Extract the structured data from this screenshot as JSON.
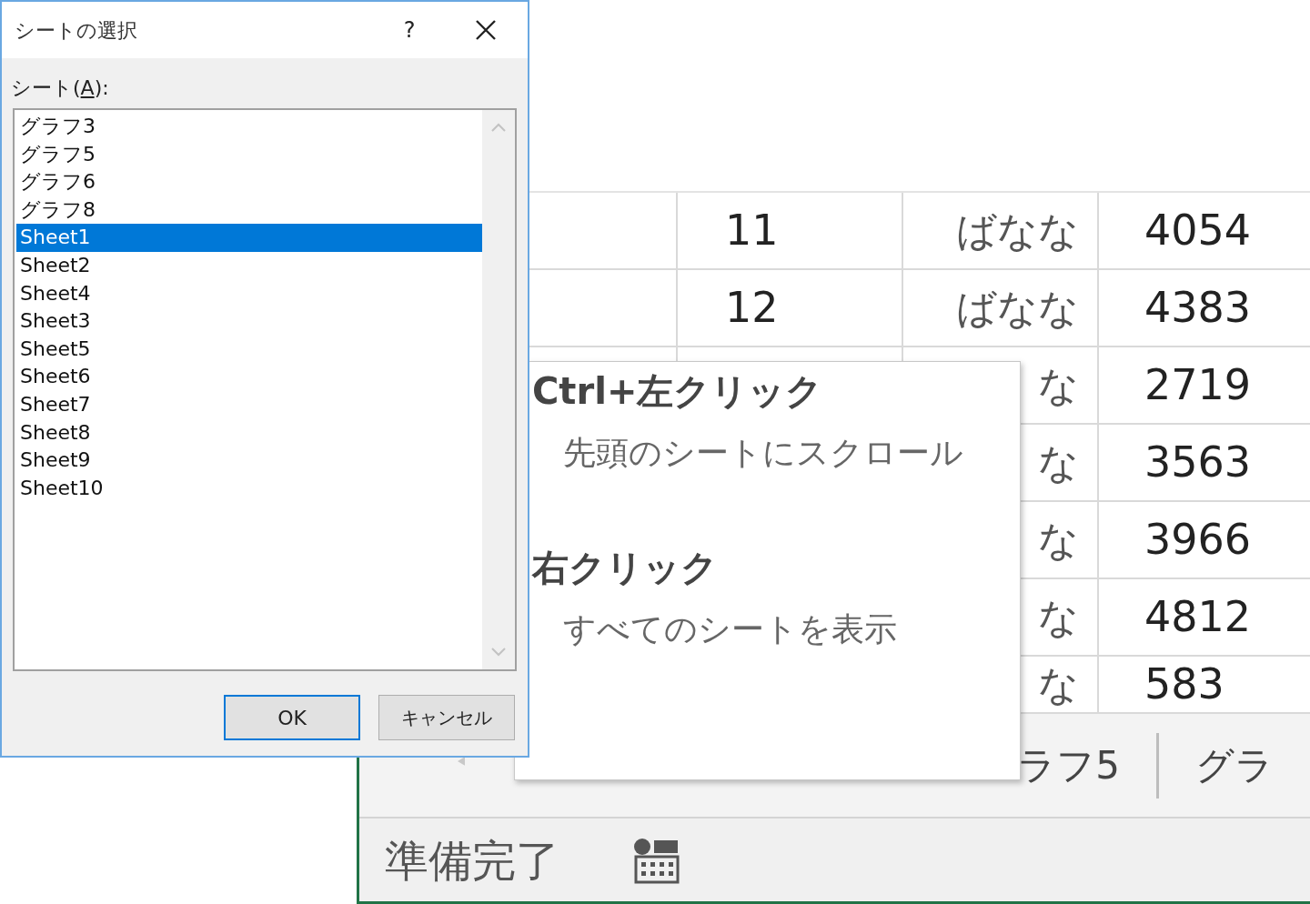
{
  "dialog": {
    "title": "シートの選択",
    "help": "?",
    "label_parts": [
      "シート(",
      "A",
      "):"
    ],
    "items": [
      {
        "label": "グラフ3",
        "selected": false
      },
      {
        "label": "グラフ5",
        "selected": false
      },
      {
        "label": "グラフ6",
        "selected": false
      },
      {
        "label": "グラフ8",
        "selected": false
      },
      {
        "label": "Sheet1",
        "selected": true
      },
      {
        "label": "Sheet2",
        "selected": false
      },
      {
        "label": "Sheet4",
        "selected": false
      },
      {
        "label": "Sheet3",
        "selected": false
      },
      {
        "label": "Sheet5",
        "selected": false
      },
      {
        "label": "Sheet6",
        "selected": false
      },
      {
        "label": "Sheet7",
        "selected": false
      },
      {
        "label": "Sheet8",
        "selected": false
      },
      {
        "label": "Sheet9",
        "selected": false
      },
      {
        "label": "Sheet10",
        "selected": false
      }
    ],
    "buttons": [
      {
        "label": "OK",
        "default": true
      },
      {
        "label": "キャンセル",
        "default": false
      }
    ]
  },
  "grid": {
    "rows": [
      [
        "11",
        "ばなな",
        "4054"
      ],
      [
        "12",
        "ばなな",
        "4383"
      ],
      [
        "",
        "な",
        "2719"
      ],
      [
        "",
        "な",
        "3563"
      ],
      [
        "",
        "な",
        "3966"
      ],
      [
        "",
        "な",
        "4812"
      ],
      [
        "",
        "な",
        "583"
      ]
    ]
  },
  "tooltip": {
    "lines": [
      {
        "text": "Ctrl+左クリック",
        "kind": "heading"
      },
      {
        "text": "先頭のシートにスクロール",
        "kind": "body"
      },
      {
        "text": "右クリック",
        "kind": "heading"
      },
      {
        "text": "すべてのシートを表示",
        "kind": "body"
      }
    ]
  },
  "sheet_tabs": [
    "ラフ5",
    "グラ"
  ],
  "status_bar": {
    "text": "準備完了"
  }
}
